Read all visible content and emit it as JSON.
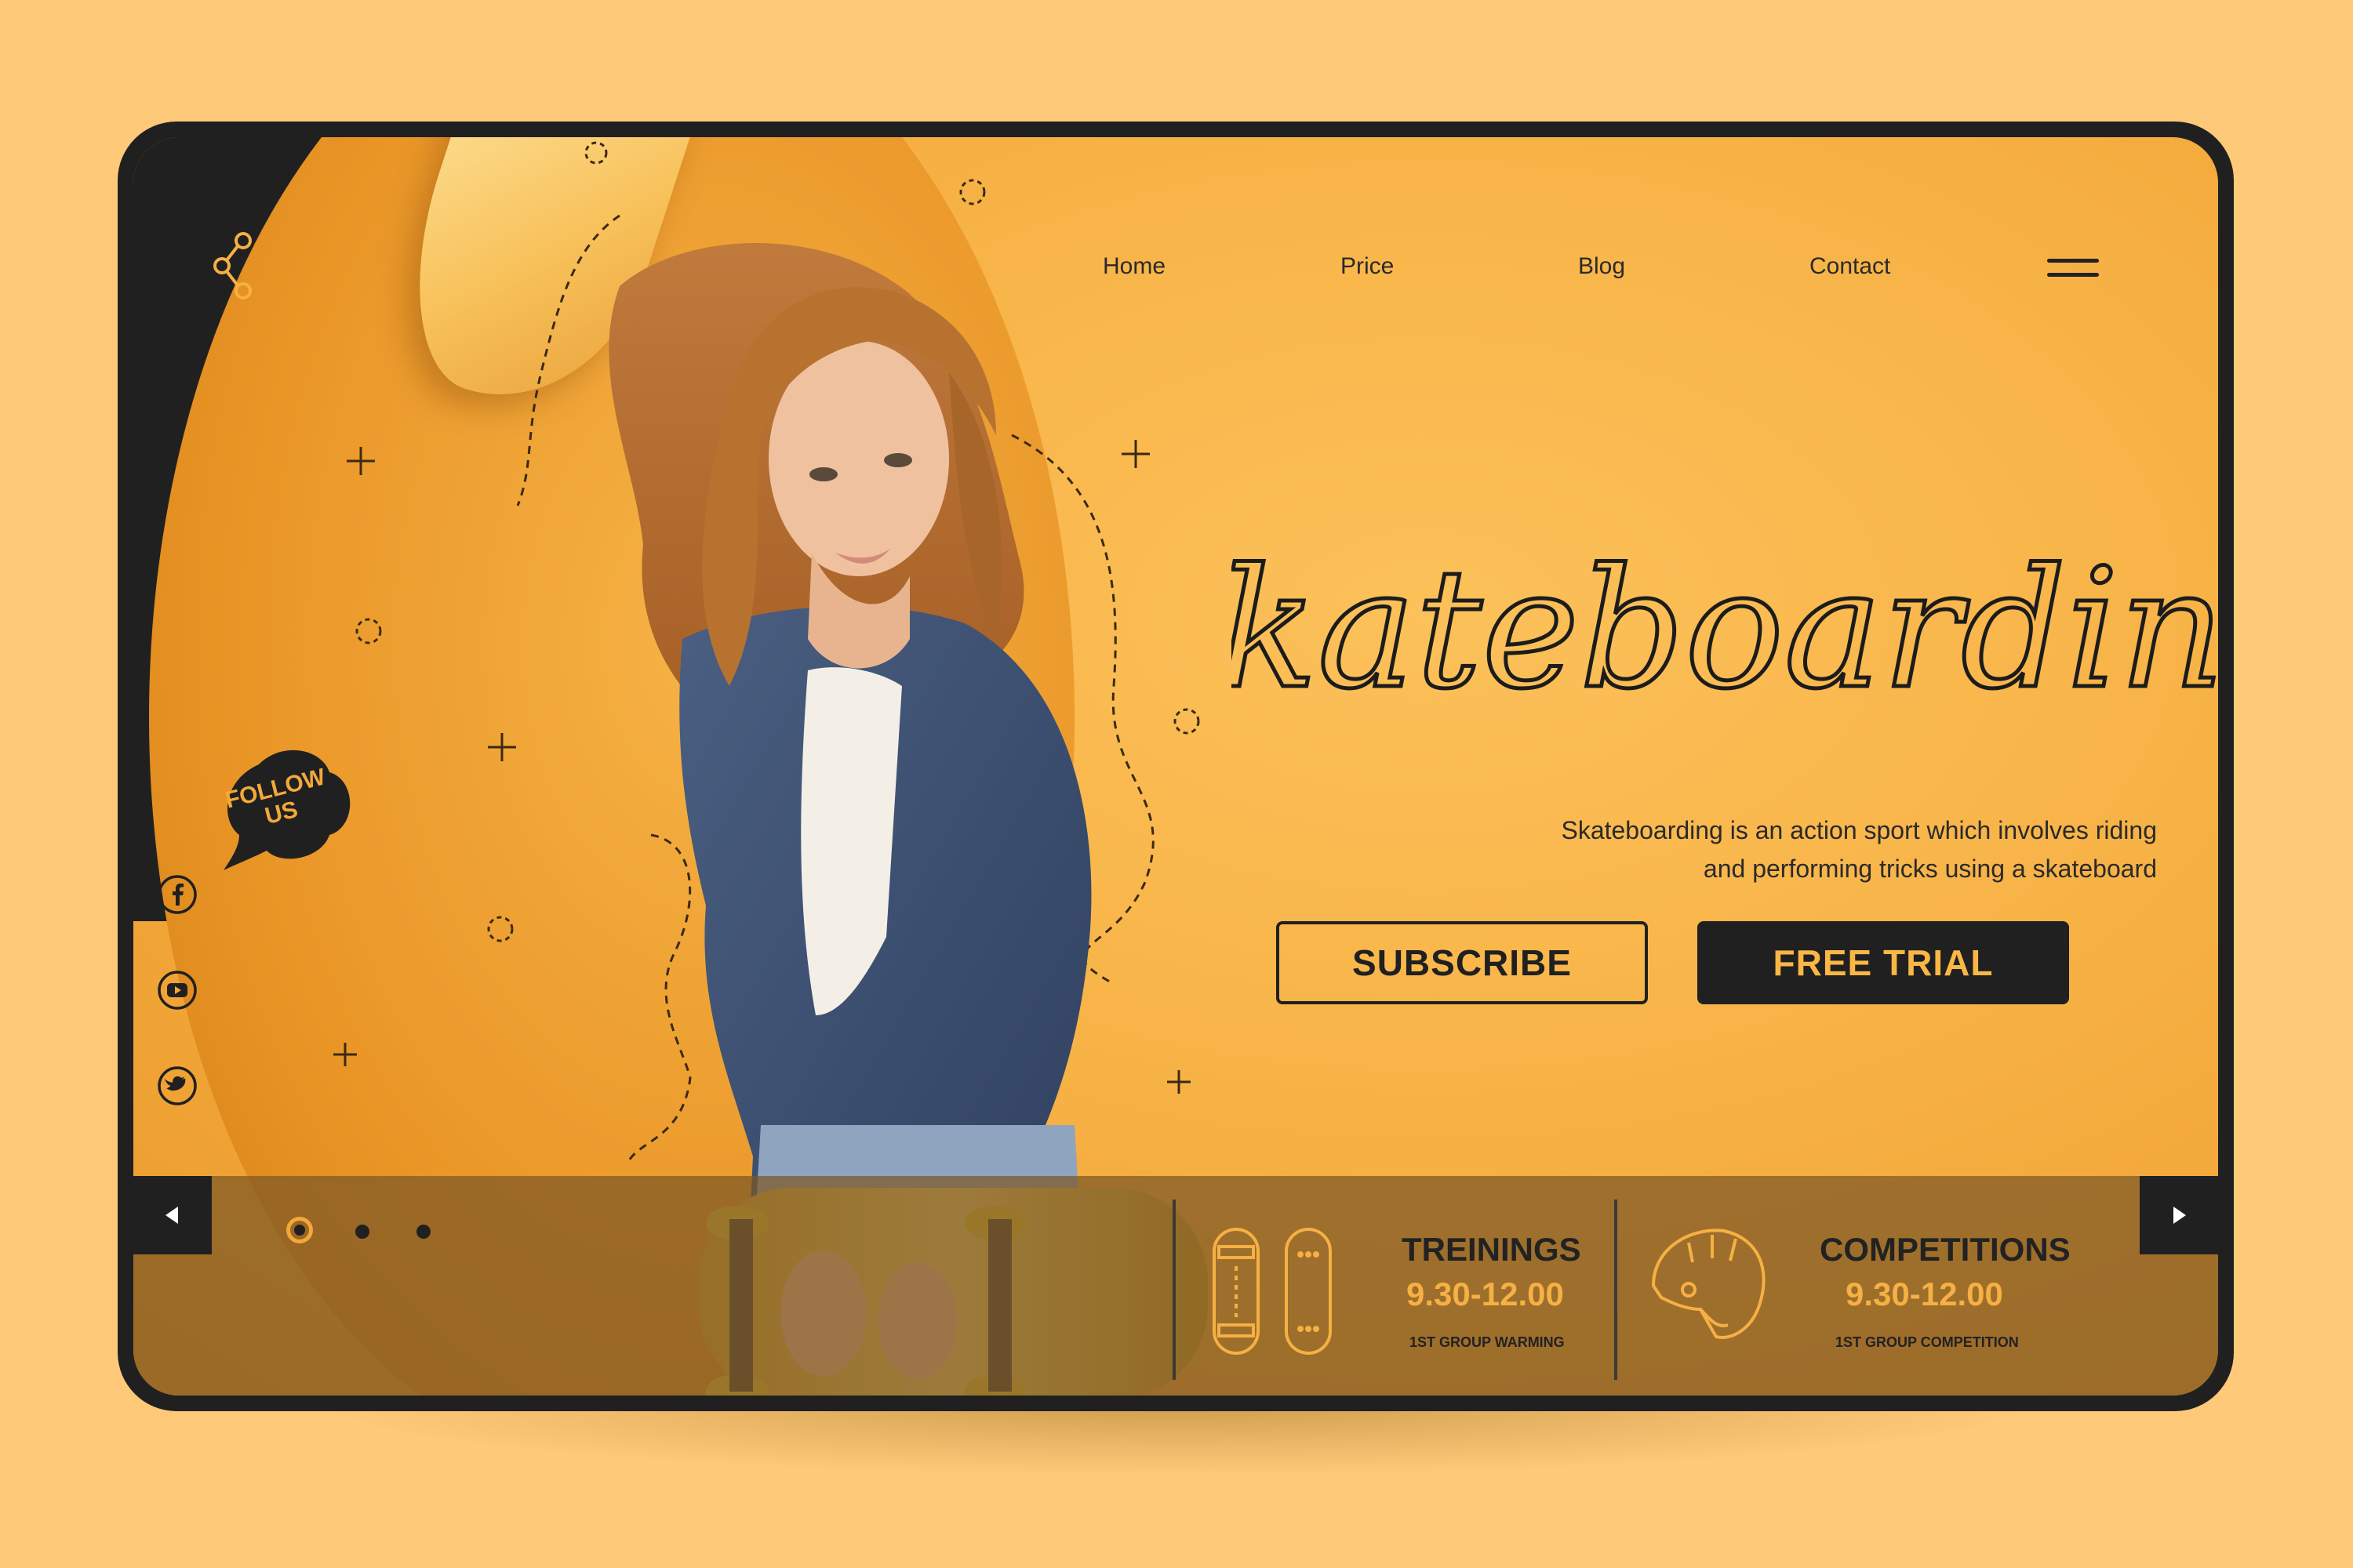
{
  "nav": {
    "items": [
      {
        "label": "Home"
      },
      {
        "label": "Price"
      },
      {
        "label": "Blog"
      },
      {
        "label": "Contact"
      }
    ]
  },
  "hero": {
    "title": "Skateboarding",
    "description_line1": "Skateboarding is an action sport which involves riding",
    "description_line2": "and performing tricks using a skateboard",
    "subscribe_label": "SUBSCRIBE",
    "free_trial_label": "FREE TRIAL"
  },
  "social": {
    "follow_line1": "FOLLOW",
    "follow_line2": "US",
    "icons": [
      "facebook-icon",
      "youtube-icon",
      "twitter-icon"
    ]
  },
  "slider": {
    "dot_count": 3,
    "active_index": 0
  },
  "info": [
    {
      "title": "TREININGS",
      "time": "9.30-12.00",
      "subtitle": "1ST GROUP WARMING",
      "icon": "skateboard-icon"
    },
    {
      "title": "COMPETITIONS",
      "time": "9.30-12.00",
      "subtitle": "1ST GROUP COMPETITION",
      "icon": "helmet-icon"
    }
  ],
  "colors": {
    "background": "#fec978",
    "accent": "#f6b043",
    "dark": "#202020"
  }
}
